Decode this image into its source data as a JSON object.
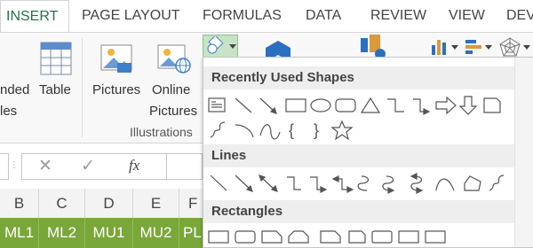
{
  "tabs": [
    {
      "label": "INSERT",
      "active": true
    },
    {
      "label": "PAGE LAYOUT"
    },
    {
      "label": "FORMULAS"
    },
    {
      "label": "DATA"
    },
    {
      "label": "REVIEW"
    },
    {
      "label": "VIEW"
    },
    {
      "label": "DEV"
    }
  ],
  "ribbon": {
    "tables_partial_1": "nded",
    "tables_partial_2": "les",
    "table": "Table",
    "pictures": "Pictures",
    "online_pictures_1": "Online",
    "online_pictures_2": "Pictures",
    "illustrations_group": "Illustrations"
  },
  "formula_bar": {
    "cancel": "✕",
    "enter": "✓",
    "fx": "fx"
  },
  "columns": [
    "B",
    "C",
    "D",
    "E",
    "F"
  ],
  "row_cells": [
    "ML1",
    "ML2",
    "MU1",
    "MU2",
    "PL"
  ],
  "colors": {
    "accent": "#217346",
    "header_row": "#7aa739"
  },
  "shapes_menu": {
    "recent_heading": "Recently Used Shapes",
    "lines_heading": "Lines",
    "rectangles_heading": "Rectangles"
  }
}
